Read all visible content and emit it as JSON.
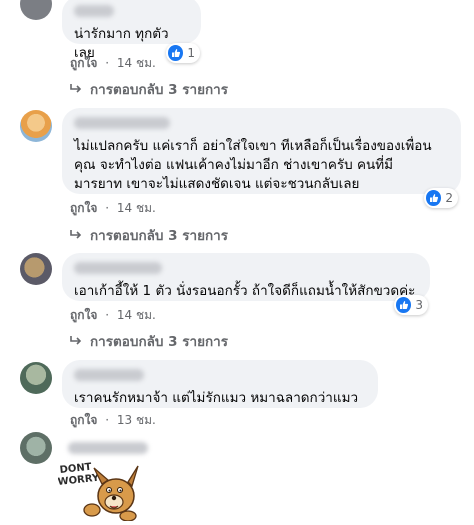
{
  "colors": {
    "bubble_bg": "#f0f2f5",
    "like_blue": "#1877f2",
    "secondary_text": "#65676b"
  },
  "comments": [
    {
      "text": "น่ารักมาก ทุกตัวเลย",
      "reaction_count": "1",
      "like_label": "ถูกใจ",
      "separator": "·",
      "time": "14 ชม.",
      "replies_label": "การตอบกลับ 3 รายการ"
    },
    {
      "text": "ไม่แปลกครับ แค่เราก็ อย่าใส่ใจเขา ทีเหลือก็เป็นเรื่องของเพื่อน\nคุณ จะทำไงต่อ แฟนเค้าคงไม่มาอีก ช่างเขาครับ คนที่มี\nมารยาท เขาจะไม่แสดงชัดเจน แต่จะชวนกลับเลย",
      "reaction_count": "2",
      "like_label": "ถูกใจ",
      "separator": "·",
      "time": "14 ชม.",
      "replies_label": "การตอบกลับ 3 รายการ"
    },
    {
      "text": "เอาเก้าอี้ให้ 1 ตัว นั่งรอนอกรั้ว ถ้าใจดีก็แถมน้ำให้สักขวดค่ะ",
      "reaction_count": "3",
      "like_label": "ถูกใจ",
      "separator": "·",
      "time": "14 ชม.",
      "replies_label": "การตอบกลับ 3 รายการ"
    },
    {
      "text": "เราคนรักหมาจ้า แต่ไม่รักแมว หมาฉลาดกว่าแมว",
      "like_label": "ถูกใจ",
      "separator": "·",
      "time": "13 ชม."
    }
  ],
  "sticker": {
    "line1": "DONT",
    "line2": "WORRY",
    "icon": "dog-sticker-icon"
  }
}
